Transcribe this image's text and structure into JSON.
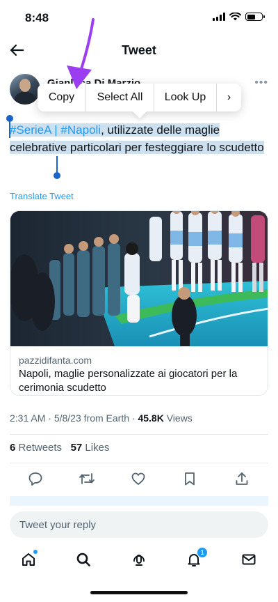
{
  "status_bar": {
    "time": "8:48",
    "battery_level": 0.55
  },
  "header": {
    "title": "Tweet"
  },
  "author": {
    "name_visible": "Gianluca Di Marzio"
  },
  "context_menu": {
    "items": [
      "Copy",
      "Select All",
      "Look Up",
      "›"
    ]
  },
  "tweet": {
    "hashtag_1": "#SerieA",
    "separator": " | ",
    "hashtag_2": "#Napoli",
    "body": ", utilizzate delle maglie celebrative particolari per festeggiare lo scudetto",
    "translate_label": "Translate Tweet"
  },
  "link_card": {
    "domain": "pazzidifanta.com",
    "title": "Napoli, maglie personalizzate ai giocatori per la cerimonia scudetto"
  },
  "meta": {
    "time": "2:31 AM",
    "date": "5/8/23",
    "source": "from Earth",
    "views_count": "45.8K",
    "views_label": "Views"
  },
  "stats": {
    "retweets_count": "6",
    "retweets_label": "Retweets",
    "likes_count": "57",
    "likes_label": "Likes"
  },
  "reply": {
    "placeholder": "Tweet your reply"
  },
  "tabbar": {
    "notifications_badge": "1"
  },
  "colors": {
    "accent": "#1d9bf0",
    "selection": "#cde0ef",
    "selection_handle": "#1a64c8",
    "annotation_arrow": "#9b3df0"
  },
  "icons": {
    "back": "arrow-left-icon",
    "more": "more-dots-icon",
    "reply": "speech-bubble-icon",
    "retweet": "retweet-icon",
    "like": "heart-icon",
    "bookmark": "bookmark-icon",
    "share": "share-icon",
    "home": "home-icon",
    "search": "search-icon",
    "spaces": "spaces-icon",
    "notifications": "bell-icon",
    "messages": "envelope-icon"
  }
}
